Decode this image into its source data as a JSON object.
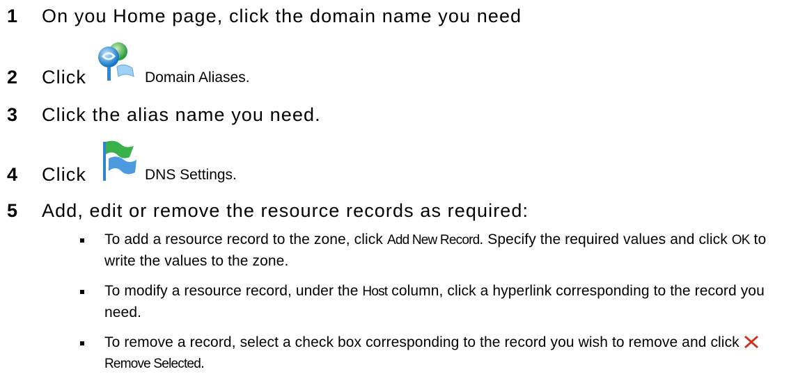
{
  "steps": [
    {
      "number": "1",
      "text": "On you Home page, click the domain name you need"
    },
    {
      "number": "2",
      "text_before": "Click",
      "icon": "domain-aliases-icon",
      "ui_label": "Domain Aliases."
    },
    {
      "number": "3",
      "text": "Click the alias name you need."
    },
    {
      "number": "4",
      "text_before": "Click",
      "icon": "dns-settings-flag-icon",
      "ui_label": "DNS Settings."
    },
    {
      "number": "5",
      "text": "Add, edit or remove the resource records as required:"
    }
  ],
  "bullets": [
    {
      "pre": "To add a resource record to the zone, click ",
      "kw1": "Add New Record",
      "mid": ". Specify the required values and click ",
      "kw2": "OK",
      "post": " to write the values to the zone."
    },
    {
      "pre": "To modify a resource record, under the ",
      "kw1": "Host",
      "post": " column, click a hyperlink corresponding to the record you need."
    },
    {
      "pre": "To remove a record, select a check box corresponding to the record you wish to remove and click ",
      "icon": "remove-x-icon",
      "kw1": "Remove Selected",
      "post": "."
    }
  ],
  "colors": {
    "remove_icon": "#d42a1c",
    "flag_green": "#2fa53a",
    "flag_blue": "#3f8fd8",
    "globe_blue": "#1f8ad3",
    "globe_green": "#34a853"
  }
}
